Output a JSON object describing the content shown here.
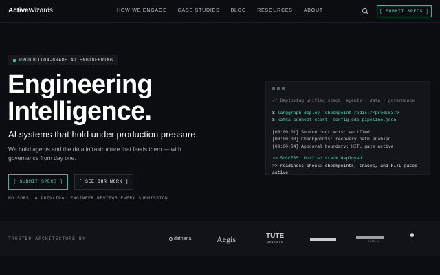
{
  "nav": {
    "logo_bold": "Active",
    "logo_rest": "Wizards",
    "links": [
      "HOW WE ENGAGE",
      "CASE STUDIES",
      "BLOG",
      "RESOURCES",
      "ABOUT"
    ],
    "search_icon": "search-icon",
    "cta": "[ SUBMIT SPECS ]"
  },
  "hero": {
    "badge": "PRODUCTION-GRADE AI ENGINEERING",
    "title_line1": "Engineering",
    "title_line2": "Intelligence.",
    "subtitle": "AI systems that hold under production pressure.",
    "description": "We build agents and the data infrastructure that feeds them — with governance from day one.",
    "primary_button": "[ SUBMIT SPECS ]",
    "secondary_button": "[ SEE OUR WORK ]",
    "note": "NO SDRS. A PRINCIPAL ENGINEER REVIEWS EVERY SUBMISSION."
  },
  "terminal": {
    "comment": "// Deploying unified stack: agents + data + governance",
    "cmd1_prompt": "$ ",
    "cmd1": "langgraph deploy--checkpoint redis://prod:6379",
    "cmd2_prompt": "$ ",
    "cmd2": "kafka-connect start--config cdc-pipeline.json",
    "log1": "[00:00:01] Source contracts: verified",
    "log2": "[00:00:03] Checkpoints: recovery path enabled",
    "log3": "[00:00:04] Approval boundary: HITL gate active",
    "success": ">> SUCCESS: Unified stack deployed",
    "readiness": ">> readiness check: checkpoints, traces, and HITL gates active"
  },
  "trusted": {
    "label": "TRUSTED ARCHITECTURE BY",
    "logos": {
      "dathena": "dathena",
      "aegis": "Aegis",
      "tute": "TUTE",
      "tute_sub": "GENOMICS",
      "safe": "SAFE-BL"
    }
  },
  "colors": {
    "accent": "#21c49a",
    "background": "#0b0d10",
    "terminal_bg": "#121519"
  }
}
